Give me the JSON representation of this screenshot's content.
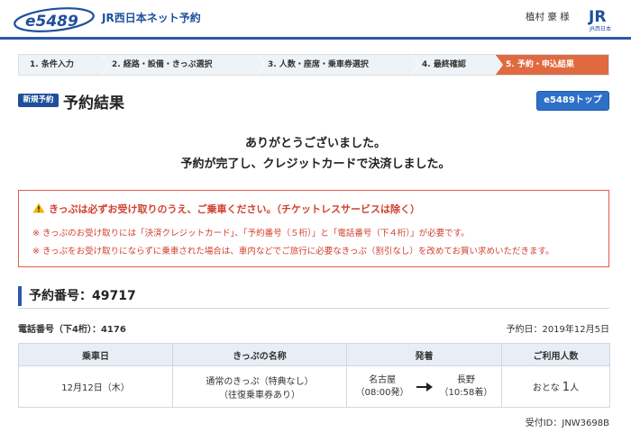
{
  "header": {
    "logo_text": "e5489",
    "title": "JR西日本ネット予約",
    "user": "植村 豪 様",
    "jr_logo_text": "JR西日本"
  },
  "steps": [
    {
      "label": "1. 条件入力",
      "active": false
    },
    {
      "label": "2. 経路・設備・きっぷ選択",
      "active": false
    },
    {
      "label": "3. 人数・座席・乗車券選択",
      "active": false
    },
    {
      "label": "4. 最終確認",
      "active": false
    },
    {
      "label": "5. 予約・申込結果",
      "active": true
    }
  ],
  "title_row": {
    "badge": "新規予約",
    "title": "予約結果",
    "top_button": "e5489トップ"
  },
  "thanks": {
    "line1": "ありがとうございました。",
    "line2": "予約が完了し、クレジットカードで決済しました。"
  },
  "notice": {
    "icon": "warning-icon",
    "heading": "きっぷは必ずお受け取りのうえ、ご乗車ください。（チケットレスサービスは除く）",
    "lines": [
      "※ きっぷのお受け取りには「決済クレジットカード」、「予約番号（５桁）」と「電話番号（下４桁）」が必要です。",
      "※ きっぷをお受け取りにならずに乗車された場合は、車内などでご旅行に必要なきっぷ（割引なし）を改めてお買い求めいただきます。"
    ]
  },
  "reservation": {
    "number_label": "予約番号：49717",
    "tel_label": "電話番号（下4桁）：4176",
    "date_label": "予約日：2019年12月5日"
  },
  "table": {
    "headers": [
      "乗車日",
      "きっぷの名称",
      "発着",
      "ご利用人数"
    ],
    "row": {
      "date": "12月12日（木）",
      "ticket_line1": "通常のきっぷ（特典なし）",
      "ticket_line2": "（往復乗車券あり）",
      "from_station": "名古屋",
      "from_time": "（08:00発）",
      "to_station": "長野",
      "to_time": "（10:58着）",
      "pax_label": "おとな",
      "pax_count": "1",
      "pax_unit": "人"
    }
  },
  "receipt": "受付ID：JNW3698B",
  "colors": {
    "brand_blue": "#1d4f9c",
    "active_step": "#e06a3f",
    "notice_red": "#d2402e"
  }
}
